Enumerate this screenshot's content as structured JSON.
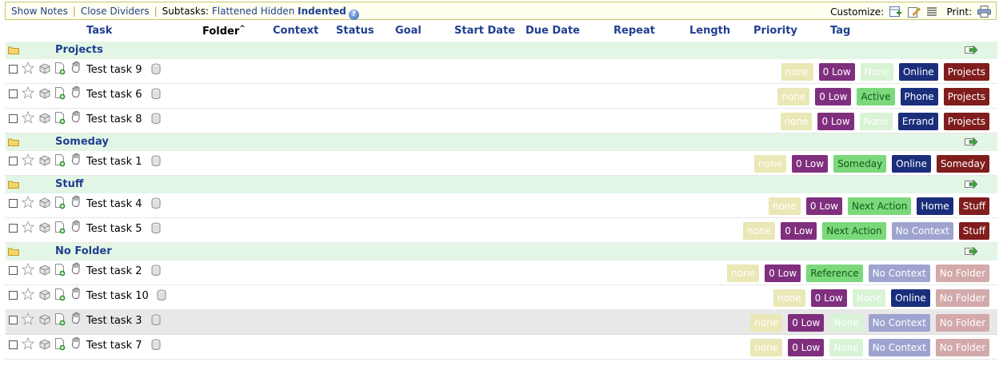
{
  "toolbar": {
    "show_notes": "Show Notes",
    "close_dividers": "Close Dividers",
    "subtasks_label": "Subtasks:",
    "flattened": "Flattened",
    "hidden": "Hidden",
    "indented": "Indented",
    "customize": "Customize:",
    "print": "Print:"
  },
  "columns": {
    "task": "Task",
    "folder": "Folder",
    "folder_sort": "^",
    "context": "Context",
    "status": "Status",
    "goal": "Goal",
    "start_date": "Start Date",
    "due_date": "Due Date",
    "repeat": "Repeat",
    "length": "Length",
    "priority": "Priority",
    "tag": "Tag"
  },
  "groups": [
    {
      "folder": "Projects",
      "tasks": [
        {
          "name": "Test task 9",
          "tags": [
            "none",
            "0 Low",
            "None",
            "Online",
            "Projects"
          ]
        },
        {
          "name": "Test task 6",
          "tags": [
            "none",
            "0 Low",
            "Active",
            "Phone",
            "Projects"
          ]
        },
        {
          "name": "Test task 8",
          "tags": [
            "none",
            "0 Low",
            "None",
            "Errand",
            "Projects"
          ]
        }
      ]
    },
    {
      "folder": "Someday",
      "tasks": [
        {
          "name": "Test task 1",
          "tags": [
            "none",
            "0 Low",
            "Someday",
            "Online",
            "Someday"
          ]
        }
      ]
    },
    {
      "folder": "Stuff",
      "tasks": [
        {
          "name": "Test task 4",
          "tags": [
            "none",
            "0 Low",
            "Next Action",
            "Home",
            "Stuff"
          ]
        },
        {
          "name": "Test task 5",
          "tags": [
            "none",
            "0 Low",
            "Next Action",
            "No Context",
            "Stuff"
          ]
        }
      ]
    },
    {
      "folder": "No Folder",
      "tasks": [
        {
          "name": "Test task 2",
          "tags": [
            "none",
            "0 Low",
            "Reference",
            "No Context",
            "No Folder"
          ]
        },
        {
          "name": "Test task 10",
          "tags": [
            "none",
            "0 Low",
            "None",
            "Online",
            "No Folder"
          ]
        },
        {
          "name": "Test task 3",
          "tags": [
            "none",
            "0 Low",
            "None",
            "No Context",
            "No Folder"
          ]
        },
        {
          "name": "Test task 7",
          "tags": [
            "none",
            "0 Low",
            "None",
            "No Context",
            "No Folder"
          ]
        }
      ]
    }
  ],
  "colors": {
    "folder_bar": "#e3f6e6",
    "header_text": "#1f3f8f",
    "priority_low": "#7f2f7e",
    "context_blue": "#1a2e7c",
    "folder_red": "#801d1d"
  }
}
